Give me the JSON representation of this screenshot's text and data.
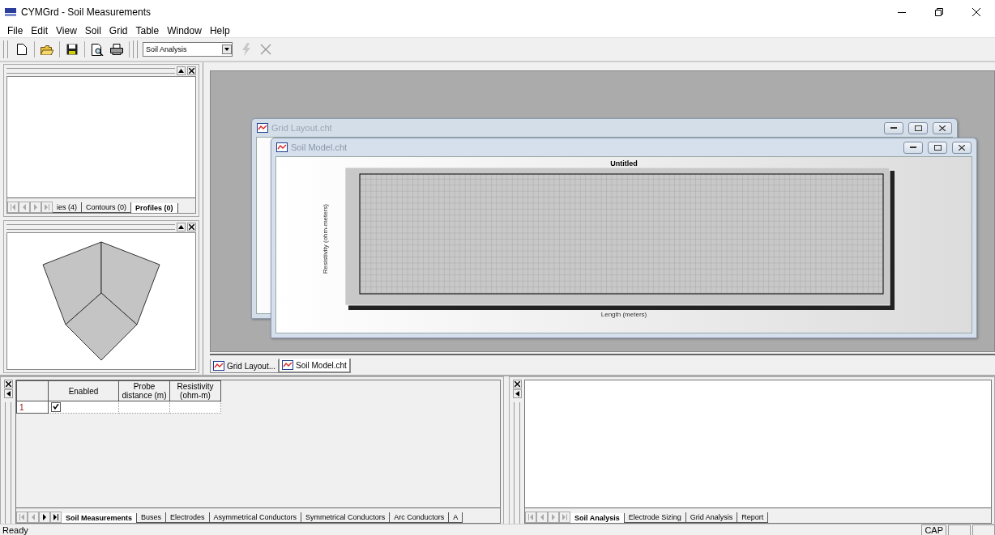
{
  "window": {
    "title": "CYMGrd - Soil Measurements"
  },
  "menu": [
    "File",
    "Edit",
    "View",
    "Soil",
    "Grid",
    "Table",
    "Window",
    "Help"
  ],
  "toolbar": {
    "combo_value": "Soil Analysis"
  },
  "left_top_panel": {
    "tabs": [
      {
        "label": "ies (4)",
        "selected": false
      },
      {
        "label": "Contours (0)",
        "selected": false
      },
      {
        "label": "Profiles (0)",
        "selected": true
      }
    ]
  },
  "mdi_windows": [
    {
      "title": "Grid Layout.cht",
      "active": false
    },
    {
      "title": "Soil Model.cht",
      "active": true,
      "chart": {
        "title": "Untitled",
        "xlabel": "Length (meters)",
        "ylabel": "Resistivity (ohm-meters)"
      }
    }
  ],
  "mdi_tabs": [
    {
      "label": "Grid Layout...",
      "selected": false
    },
    {
      "label": "Soil Model.cht",
      "selected": true
    }
  ],
  "measurements_table": {
    "columns": [
      "Enabled",
      "Probe distance (m)",
      "Resistivity (ohm-m)"
    ],
    "rows": [
      {
        "index": "1",
        "enabled": true
      }
    ]
  },
  "bottom_left_tabs": [
    {
      "label": "Soil Measurements",
      "selected": true
    },
    {
      "label": "Buses",
      "selected": false
    },
    {
      "label": "Electrodes",
      "selected": false
    },
    {
      "label": "Asymmetrical Conductors",
      "selected": false
    },
    {
      "label": "Symmetrical Conductors",
      "selected": false
    },
    {
      "label": "Arc Conductors",
      "selected": false
    },
    {
      "label": "A",
      "selected": false
    }
  ],
  "bottom_right_tabs": [
    {
      "label": "Soil Analysis",
      "selected": true
    },
    {
      "label": "Electrode Sizing",
      "selected": false
    },
    {
      "label": "Grid Analysis",
      "selected": false
    },
    {
      "label": "Report",
      "selected": false
    }
  ],
  "status_bar": {
    "text": "Ready",
    "indicators": [
      "CAP"
    ]
  }
}
